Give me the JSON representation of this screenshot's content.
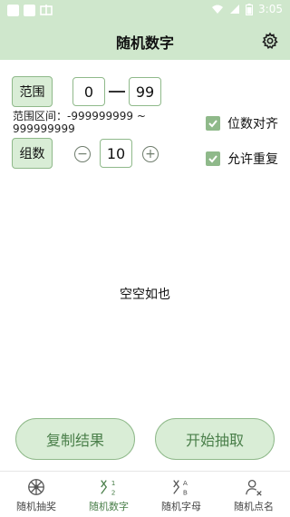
{
  "status": {
    "time": "3:05"
  },
  "appbar": {
    "title": "随机数字"
  },
  "controls": {
    "range_label": "范围",
    "range_min": "0",
    "range_max": "99",
    "range_info": "范围区间：-999999999 ~ 999999999",
    "groups_label": "组数",
    "groups_value": "10",
    "opt_digits": "位数对齐",
    "opt_repeat": "允许重复"
  },
  "main": {
    "empty": "空空如也"
  },
  "actions": {
    "copy": "复制结果",
    "start": "开始抽取"
  },
  "tabs": [
    {
      "label": "随机抽奖",
      "icon": "wheel-icon"
    },
    {
      "label": "随机数字",
      "icon": "dice-numbers-icon"
    },
    {
      "label": "随机字母",
      "icon": "dice-letters-icon"
    },
    {
      "label": "随机点名",
      "icon": "person-pick-icon"
    }
  ],
  "colors": {
    "accent": "#8fb98a",
    "accent_bg": "#d9edd6",
    "header": "#cfe7cc"
  }
}
